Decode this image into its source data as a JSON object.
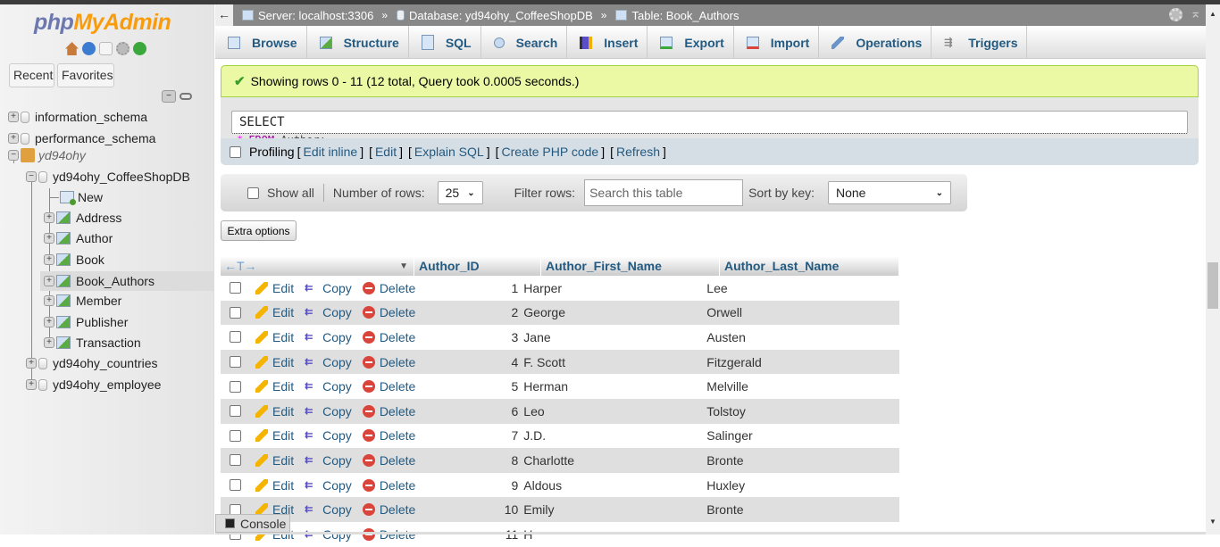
{
  "app": {
    "logo_part1": "php",
    "logo_part2": "MyAdmin"
  },
  "sidebar": {
    "nav_icons": [
      "home-icon",
      "help-icon",
      "docs-icon",
      "settings-icon",
      "reload-icon"
    ],
    "recent_label": "Recent",
    "favorites_label": "Favorites",
    "tree": [
      {
        "label": "information_schema",
        "type": "database",
        "expanded": false
      },
      {
        "label": "performance_schema",
        "type": "database",
        "expanded": false
      },
      {
        "label": "yd94ohy",
        "type": "group",
        "expanded": true
      },
      {
        "label": "yd94ohy_CoffeeShopDB",
        "type": "database",
        "expanded": true
      },
      {
        "label": "New",
        "type": "new"
      },
      {
        "label": "Address",
        "type": "table"
      },
      {
        "label": "Author",
        "type": "table"
      },
      {
        "label": "Book",
        "type": "table"
      },
      {
        "label": "Book_Authors",
        "type": "table",
        "highlighted": true
      },
      {
        "label": "Member",
        "type": "table"
      },
      {
        "label": "Publisher",
        "type": "table"
      },
      {
        "label": "Transaction",
        "type": "table"
      },
      {
        "label": "yd94ohy_countries",
        "type": "database",
        "expanded": false
      },
      {
        "label": "yd94ohy_employee",
        "type": "database",
        "expanded": false
      }
    ]
  },
  "breadcrumb": {
    "back": "←",
    "server": "Server: localhost:3306",
    "database": "Database: yd94ohy_CoffeeShopDB",
    "table": "Table: Book_Authors",
    "separator": "»"
  },
  "tabs": [
    {
      "label": "Browse",
      "icon": "browse-icon"
    },
    {
      "label": "Structure",
      "icon": "structure-icon"
    },
    {
      "label": "SQL",
      "icon": "sql-icon"
    },
    {
      "label": "Search",
      "icon": "search-icon"
    },
    {
      "label": "Insert",
      "icon": "insert-icon"
    },
    {
      "label": "Export",
      "icon": "export-icon"
    },
    {
      "label": "Import",
      "icon": "import-icon"
    },
    {
      "label": "Operations",
      "icon": "operations-icon"
    },
    {
      "label": "Triggers",
      "icon": "triggers-icon"
    }
  ],
  "message": {
    "success": "Showing rows 0 - 11 (12 total, Query took 0.0005 seconds.)"
  },
  "sql": {
    "select": "SELECT",
    "star": "*",
    "from": "FROM",
    "table": "Author;"
  },
  "profiling": {
    "label": "Profiling",
    "links": [
      "Edit inline",
      "Edit",
      "Explain SQL",
      "Create PHP code",
      "Refresh"
    ]
  },
  "navbar": {
    "show_all": "Show all",
    "num_rows_label": "Number of rows:",
    "num_rows_value": "25",
    "filter_label": "Filter rows:",
    "filter_placeholder": "Search this table",
    "sort_label": "Sort by key:",
    "sort_value": "None"
  },
  "extra_options": "Extra options",
  "grid": {
    "columns": [
      "Author_ID",
      "Author_First_Name",
      "Author_Last_Name"
    ],
    "actions": {
      "edit": "Edit",
      "copy": "Copy",
      "delete": "Delete"
    },
    "rows": [
      {
        "id": "1",
        "first": "Harper",
        "last": "Lee"
      },
      {
        "id": "2",
        "first": "George",
        "last": "Orwell"
      },
      {
        "id": "3",
        "first": "Jane",
        "last": "Austen"
      },
      {
        "id": "4",
        "first": "F. Scott",
        "last": "Fitzgerald"
      },
      {
        "id": "5",
        "first": "Herman",
        "last": "Melville"
      },
      {
        "id": "6",
        "first": "Leo",
        "last": "Tolstoy"
      },
      {
        "id": "7",
        "first": "J.D.",
        "last": "Salinger"
      },
      {
        "id": "8",
        "first": "Charlotte",
        "last": "Bronte"
      },
      {
        "id": "9",
        "first": "Aldous",
        "last": "Huxley"
      },
      {
        "id": "10",
        "first": "Emily",
        "last": "Bronte"
      },
      {
        "id": "11",
        "first": "H",
        "last": ""
      }
    ]
  },
  "console": {
    "label": "Console"
  }
}
